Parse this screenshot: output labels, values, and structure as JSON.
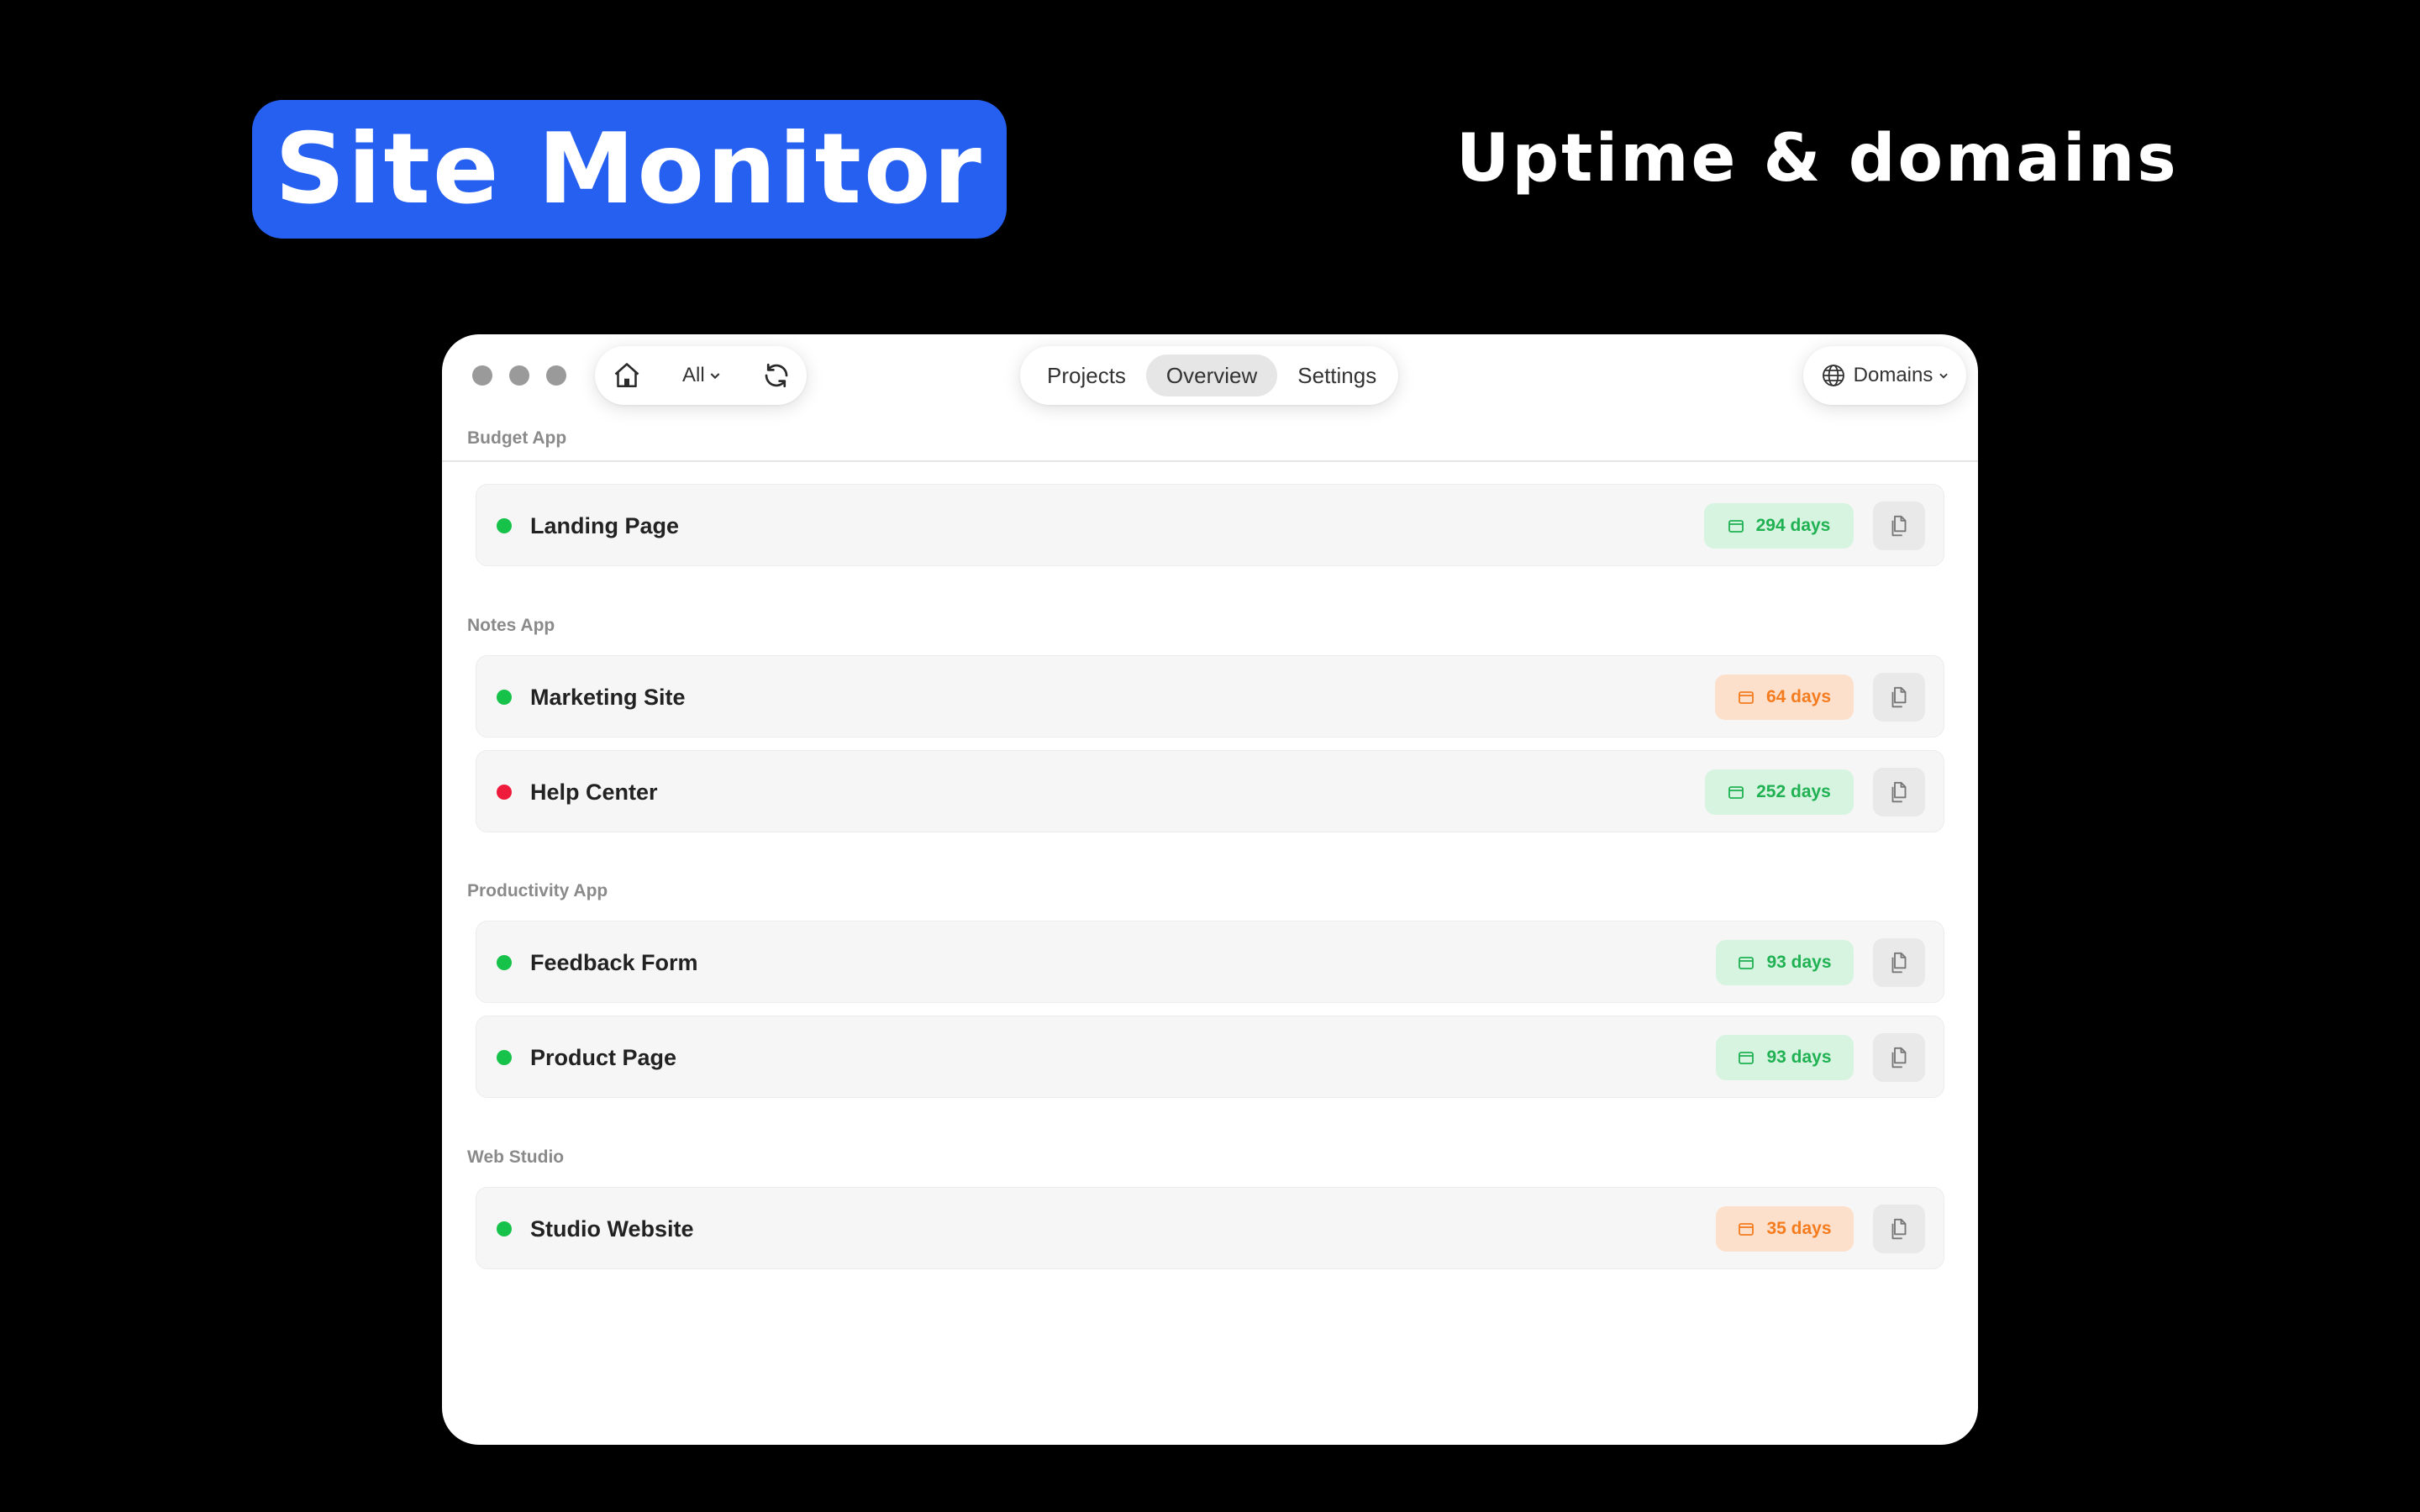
{
  "hero": {
    "title": "Site Monitor",
    "subtitle": "Uptime & domains",
    "accent_color": "#2660F0"
  },
  "toolbar": {
    "home_icon": "home-icon",
    "filter_label": "All",
    "refresh_icon": "refresh-icon",
    "tabs": [
      {
        "label": "Projects",
        "active": false
      },
      {
        "label": "Overview",
        "active": true
      },
      {
        "label": "Settings",
        "active": false
      }
    ],
    "domains_label": "Domains",
    "globe_icon": "globe-icon"
  },
  "groups": [
    {
      "name": "Budget App",
      "sites": [
        {
          "name": "Landing Page",
          "status": "up",
          "days": "294 days",
          "badge_color": "green"
        }
      ]
    },
    {
      "name": "Notes App",
      "sites": [
        {
          "name": "Marketing Site",
          "status": "up",
          "days": "64 days",
          "badge_color": "orange"
        },
        {
          "name": "Help Center",
          "status": "down",
          "days": "252 days",
          "badge_color": "green"
        }
      ]
    },
    {
      "name": "Productivity App",
      "sites": [
        {
          "name": "Feedback Form",
          "status": "up",
          "days": "93 days",
          "badge_color": "green"
        },
        {
          "name": "Product Page",
          "status": "up",
          "days": "93 days",
          "badge_color": "green"
        }
      ]
    },
    {
      "name": "Web Studio",
      "sites": [
        {
          "name": "Studio Website",
          "status": "up",
          "days": "35 days",
          "badge_color": "orange"
        }
      ]
    }
  ],
  "colors": {
    "status_up": "#16c24a",
    "status_down": "#ee1c3a",
    "badge_green_text": "#1fb152",
    "badge_orange_text": "#f47c1e"
  }
}
